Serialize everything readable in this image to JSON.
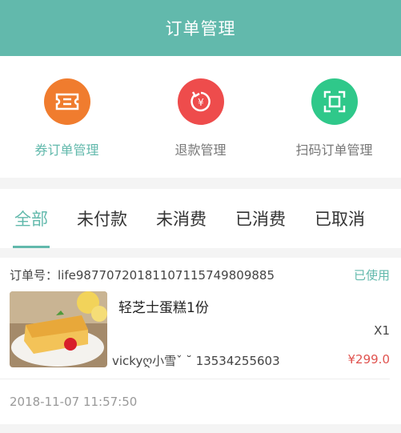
{
  "header": {
    "title": "订单管理"
  },
  "quick_actions": [
    {
      "label": "券订单管理",
      "icon": "ticket-icon",
      "color": "#f07c2e"
    },
    {
      "label": "退款管理",
      "icon": "refund-icon",
      "color": "#ee4c4c"
    },
    {
      "label": "扫码订单管理",
      "icon": "scan-icon",
      "color": "#2fc88a"
    }
  ],
  "tabs": [
    {
      "label": "全部"
    },
    {
      "label": "未付款"
    },
    {
      "label": "未消费"
    },
    {
      "label": "已消费"
    },
    {
      "label": "已取消"
    }
  ],
  "order": {
    "number_label": "订单号：",
    "number": "life98770720181107115749809885",
    "status": "已使用",
    "product_name": "轻芝士蛋糕1份",
    "quantity": "X1",
    "buyer": "vickyღ小雪ˇ  ˘ 13534255603",
    "price": "¥299.0",
    "time": "2018-11-07 11:57:50"
  },
  "colors": {
    "accent": "#62b9ac",
    "price": "#e0534f"
  }
}
